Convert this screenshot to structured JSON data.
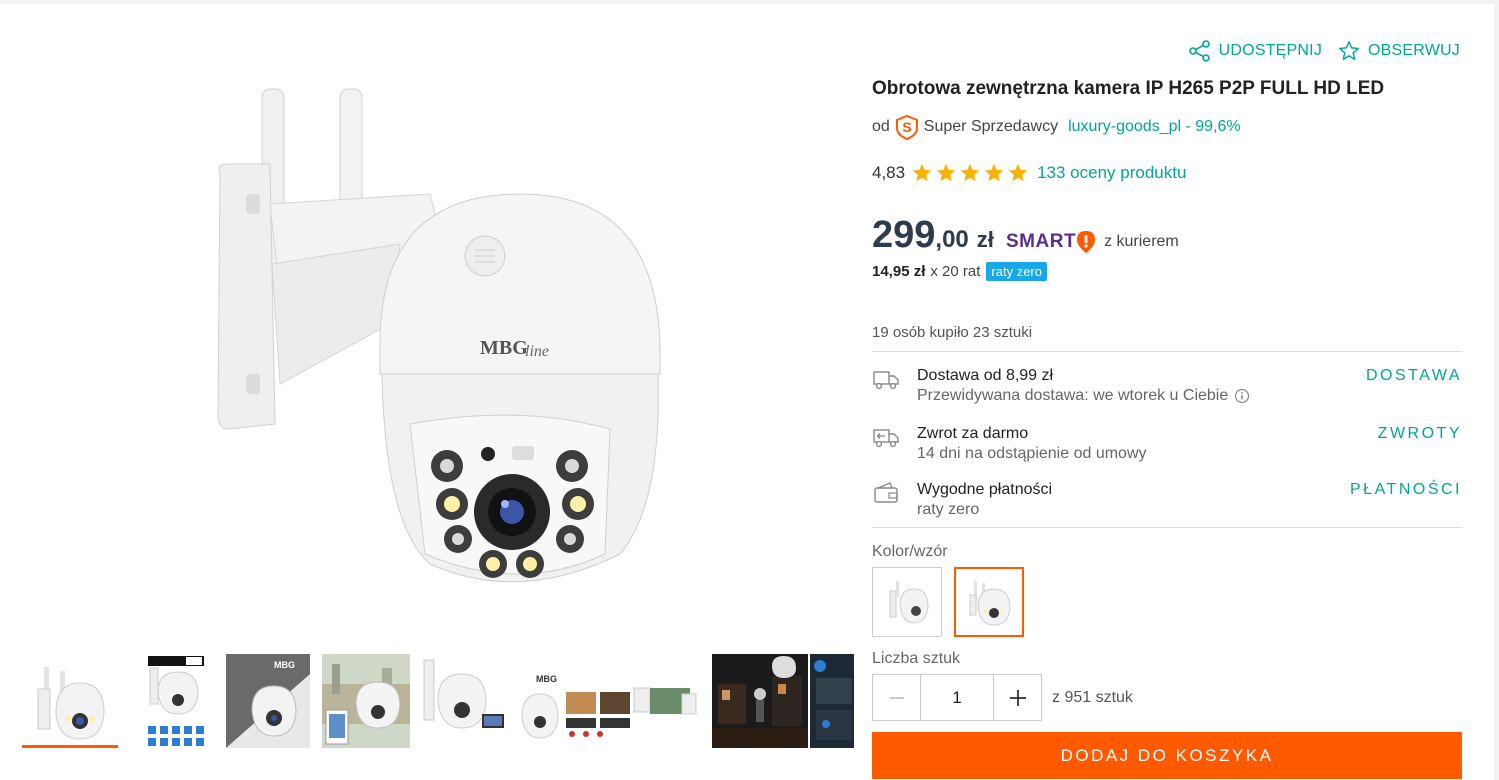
{
  "header": {
    "share_label": "UDOSTĘPNIJ",
    "watch_label": "OBSERWUJ"
  },
  "product": {
    "title": "Obrotowa zewnętrzna kamera IP H265 P2P FULL HD LED",
    "seller_prefix": "od",
    "seller_badge": "Super Sprzedawcy",
    "seller_link": "luxury-goods_pl - 99,6%",
    "image_brand": "MBG line"
  },
  "rating": {
    "score": "4,83",
    "stars": 5,
    "reviews_link": "133 oceny produktu"
  },
  "price": {
    "integer": "299",
    "decimal": ",00",
    "currency": "zł",
    "smart_label": "SMART",
    "courier": "z kurierem",
    "installment_amount": "14,95 zł",
    "installment_count": "x 20 rat",
    "installment_badge": "raty zero"
  },
  "bought_info": "19 osób kupiło 23 sztuki",
  "info_rows": [
    {
      "title": "Dostawa od 8,99 zł",
      "subtitle": "Przewidywana dostawa: we wtorek u Ciebie",
      "link": "DOSTAWA"
    },
    {
      "title": "Zwrot za darmo",
      "subtitle": "14 dni na odstąpienie od umowy",
      "link": "ZWROTY"
    },
    {
      "title": "Wygodne płatności",
      "subtitle": "raty zero",
      "link": "PŁATNOŚCI"
    }
  ],
  "variant_label": "Kolor/wzór",
  "quantity": {
    "label": "Liczba sztuk",
    "value": "1",
    "available": "z 951 sztuk"
  },
  "cart_button": "DODAJ DO KOSZYKA",
  "colors": {
    "accent": "#00a790",
    "orange": "#ff5a00",
    "smart_purple": "#5a2e8c",
    "star": "#f5b301",
    "badge_blue": "#18a8e8"
  }
}
